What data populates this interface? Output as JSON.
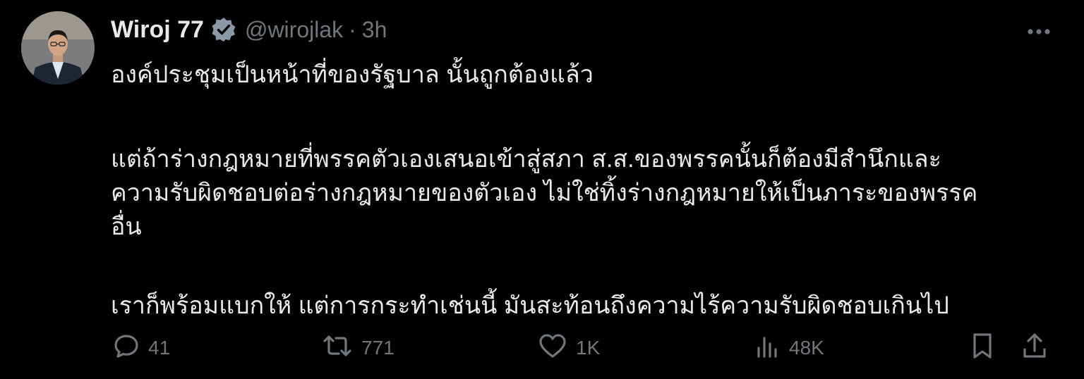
{
  "author": {
    "name": "Wiroj 77",
    "handle": "@wirojlak",
    "separator": "·",
    "time": "3h"
  },
  "icons": {
    "avatar": "profile-photo",
    "verified": "verified-badge-icon",
    "more": "more-icon",
    "reply": "reply-icon",
    "repost": "repost-icon",
    "like": "heart-icon",
    "views": "views-icon",
    "bookmark": "bookmark-icon",
    "share": "share-icon"
  },
  "tweet": {
    "p1": "องค์ประชุมเป็นหน้าที่ของรัฐบาล นั้นถูกต้องแล้ว",
    "p2_l1": "แต่ถ้าร่างกฎหมายที่พรรคตัวเองเสนอเข้าสู่สภา ส.ส.ของพรรคนั้นก็ต้องมีสำนึกและ",
    "p2_l2": "ความรับผิดชอบต่อร่างกฎหมายของตัวเอง ไม่ใช่ทิ้งร่างกฎหมายให้เป็นภาระของพรรค",
    "p2_l3": "อื่น",
    "p3": "เราก็พร้อมแบกให้ แต่การกระทำเช่นนี้ มันสะท้อนถึงความไร้ความรับผิดชอบเกินไป"
  },
  "stats": {
    "replies": "41",
    "reposts": "771",
    "likes": "1K",
    "views": "48K"
  },
  "colors": {
    "background": "#000000",
    "text": "#e7e9ea",
    "muted": "#71767b",
    "verified": "#8b98a5"
  }
}
